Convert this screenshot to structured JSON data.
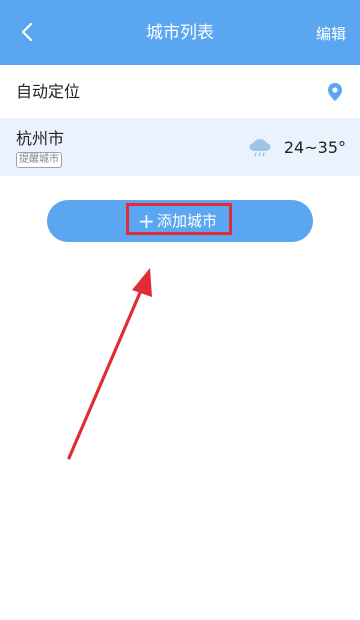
{
  "header": {
    "back_icon": "chevron-left-icon",
    "title": "城市列表",
    "edit_label": "编辑",
    "background_color": "#5aa6f0"
  },
  "auto_location": {
    "label": "自动定位",
    "icon": "location-pin-icon",
    "icon_color": "#5aa6f0"
  },
  "cities": [
    {
      "name": "杭州市",
      "badge": "提醒城市",
      "weather_icon": "cloudy-icon",
      "temperature": "24~35°",
      "row_color": "#eaf3fd"
    }
  ],
  "add_city": {
    "plus": "+",
    "label": "添加城市",
    "background_color": "#5aa6f0"
  },
  "annotation": {
    "highlight_color": "#e02d35",
    "arrow_color": "#e02d35"
  }
}
